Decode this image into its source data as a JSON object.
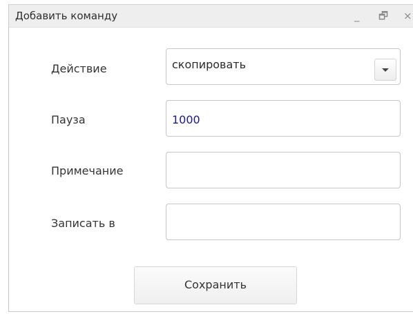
{
  "window": {
    "title": "Добавить команду",
    "controls": {
      "minimize": "_",
      "restore": "🗗",
      "close": "×"
    }
  },
  "form": {
    "action": {
      "label": "Действие",
      "value": "скопировать"
    },
    "pause": {
      "label": "Пауза",
      "value": "1000"
    },
    "note": {
      "label": "Примечание",
      "value": ""
    },
    "write_to": {
      "label": "Записать в",
      "value": ""
    }
  },
  "buttons": {
    "save_label": "Сохранить"
  },
  "icons": {
    "minimize": "minimize-icon",
    "restore": "restore-icon",
    "close": "close-icon",
    "dropdown": "chevron-down-icon"
  },
  "colors": {
    "titlebar_bg": "#eeeeee",
    "field_border": "#c6c6c6",
    "input_value_text": "#1a1a8c",
    "button_bg": "#efefef"
  }
}
